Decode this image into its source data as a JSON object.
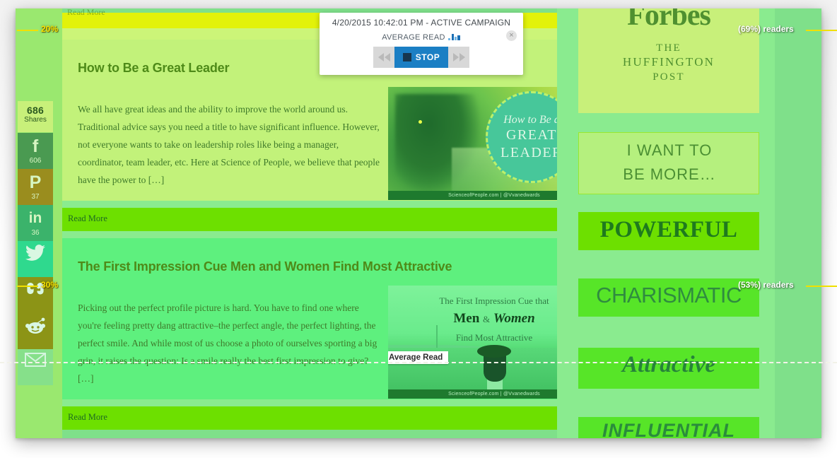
{
  "panel": {
    "title": "4/20/2015 10:42:01 PM - ACTIVE CAMPAIGN",
    "subtitle": "AVERAGE READ",
    "bars_icon": "bar-chart-icon",
    "close_label": "×",
    "prev_label": "◀◀",
    "next_label": "▶▶",
    "stop_label": "STOP"
  },
  "share_rail": {
    "total": "686",
    "total_label": "Shares",
    "items": [
      {
        "icon": "facebook-icon",
        "glyph": "f",
        "count": "606"
      },
      {
        "icon": "pinterest-icon",
        "glyph": "P",
        "count": "37"
      },
      {
        "icon": "linkedin-icon",
        "glyph": "in",
        "count": "36"
      },
      {
        "icon": "twitter-icon",
        "glyph": "",
        "count": ""
      },
      {
        "icon": "stumbleupon-icon",
        "glyph": "",
        "count": ""
      },
      {
        "icon": "reddit-icon",
        "glyph": "",
        "count": ""
      },
      {
        "icon": "email-icon",
        "glyph": "",
        "count": ""
      }
    ]
  },
  "markers": {
    "left": [
      {
        "id": "scroll-20",
        "label": "20%"
      },
      {
        "id": "scroll-30",
        "label": "30%"
      }
    ],
    "right": [
      {
        "id": "readers-69",
        "label": "(69%) readers"
      },
      {
        "id": "readers-53",
        "label": "(53%) readers"
      }
    ],
    "average_read_label": "Average Read"
  },
  "top_bar": {
    "read_more": "Read More"
  },
  "articles": [
    {
      "title": "How to Be a Great Leader",
      "excerpt": "We all have great ideas and the ability to improve the world around us. Traditional advice says you need a title to have significant influence. However, not everyone wants to take on leadership roles like being a manager, coordinator, team leader, etc. Here at Science of People, we believe that people have the power to […]",
      "read_more": "Read More",
      "thumb": {
        "badge_line1": "How to Be a",
        "badge_line2": "GREAT",
        "badge_line3": "LEADER",
        "footer": "ScienceofPeople.com | @Vvanedwards"
      }
    },
    {
      "title": "The First Impression Cue Men and Women Find Most Attractive",
      "excerpt": "Picking out the perfect profile picture is hard. You have to find one where you're feeling pretty dang attractive–the perfect angle, the perfect lighting, the perfect smile. And while most of us choose a photo of ourselves sporting a big grin, it raises the question: Is a smile really the best first impression to give? […]",
      "read_more": "Read More",
      "thumb": {
        "line1": "The First Impression Cue that",
        "line2_a": "Men",
        "line2_amp": "&",
        "line2_b": "Women",
        "line3": "Find Most Attractive",
        "footer": "ScienceofPeople.com | @Vvanedwards"
      }
    }
  ],
  "sidebar": {
    "press": {
      "forbes": "Forbes",
      "huffington_l1": "THE",
      "huffington_l2": "HUFFINGTON",
      "huffington_l3": "POST"
    },
    "want_to": {
      "line1": "I WANT TO",
      "line2": "BE MORE…"
    },
    "tags": [
      {
        "id": "powerful",
        "label": "POWERFUL"
      },
      {
        "id": "charismatic",
        "label": "CHARISMATIC"
      },
      {
        "id": "attractive",
        "label": "Attractive"
      },
      {
        "id": "influential",
        "label": "INFLUENTIAL"
      }
    ]
  },
  "colors": {
    "heat_hot": "#e2f20a",
    "heat_warm": "#c2f27a",
    "heat_mid": "#8aeb8f",
    "heat_cool": "#5ef07e",
    "marker_yellow": "#f0e000",
    "panel_accent": "#1b7fc4"
  }
}
